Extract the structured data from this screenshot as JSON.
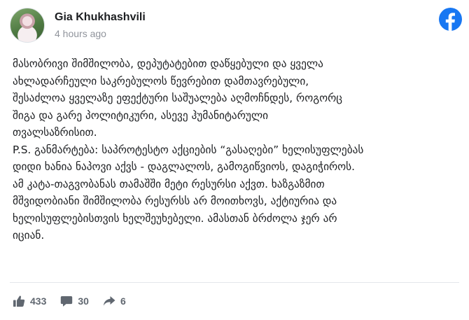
{
  "post": {
    "author": "Gia Khukhashvili",
    "timestamp": "4 hours ago",
    "source_icon": "facebook-icon",
    "brand_color": "#1877f2",
    "body_lines": [
      "მასობრივი შიმშილობა, დეპუტატებით დაწყებული და ყველა",
      "ახლადარჩეული საკრებულოს წევრებით დამთავრებული,",
      "შესაძლოა ყველაზე ეფექტური საშუალება აღმოჩნდეს, როგორც",
      "შიგა და გარე პოლიტიკური, ასევე ჰუმანიტარული",
      "თვალსაზრისით.",
      "P.S. განმარტება: საპროტესტო აქციების “გასაღები” ხელისუფლებას",
      "დიდი ხანია ნაპოვი აქვს - დაგლალოს, გამოგიწვიოს, დაგიჭიროს.",
      "ამ კატა-თაგვობანას თამაშში მეტი რესურსი აქვთ. ხაზგაზმით",
      "მშვიდობიანი შიმშილობა რესურსს არ მოითხოვს, აქტიურია და",
      "ხელისუფლებისთვის ხელშეუხებელი. ამასთან ბრძოლა ჯერ არ",
      "იციან."
    ]
  },
  "engagement": {
    "likes": "433",
    "comments": "30",
    "shares": "6",
    "icons": [
      "like-icon",
      "comment-icon",
      "share-icon"
    ],
    "icon_color": "#606770"
  }
}
